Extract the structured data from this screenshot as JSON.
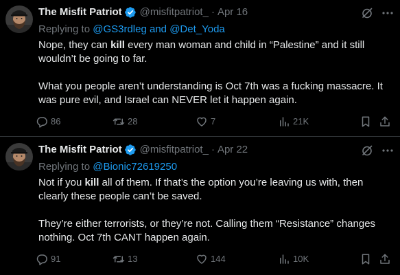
{
  "tweets": [
    {
      "author": {
        "name": "The Misfit Patriot",
        "handle": "@misfitpatriot_",
        "verified": true,
        "avatar": "avatar-bearded-man-cap"
      },
      "separator": "·",
      "date": "Apr 16",
      "reply": {
        "prefix": "Replying to ",
        "mention_1": "@GS3rdleg",
        "joiner": " and ",
        "mention_2": "@Det_Yoda"
      },
      "text": {
        "p1_before": "Nope, they can ",
        "p1_bold": "kill",
        "p1_after": " every man woman and child in “Palestine” and it still wouldn’t be going to far.",
        "p2": "What you people aren’t understanding is Oct 7th was a fucking massacre. It was pure evil, and Israel can NEVER let it happen again."
      },
      "stats": {
        "replies": "86",
        "reposts": "28",
        "likes": "7",
        "views": "21K"
      }
    },
    {
      "author": {
        "name": "The Misfit Patriot",
        "handle": "@misfitpatriot_",
        "verified": true,
        "avatar": "avatar-bearded-man-cap"
      },
      "separator": "·",
      "date": "Apr 22",
      "reply": {
        "prefix": "Replying to ",
        "mention_1": "@Bionic72619250"
      },
      "text": {
        "p1_before": "Not if you ",
        "p1_bold": "kill",
        "p1_after": " all of them. If that’s the option you’re leaving us with, then clearly these people can’t be saved.",
        "p2": "They’re either terrorists, or they’re not. Calling them “Resistance” changes nothing. Oct 7th CANT happen again."
      },
      "stats": {
        "replies": "91",
        "reposts": "13",
        "likes": "144",
        "views": "10K"
      }
    }
  ],
  "icons": {
    "verified_badge": "verified-badge-icon",
    "grok": "grok-icon",
    "more": "more-options-icon",
    "reply": "reply-icon",
    "repost": "repost-icon",
    "like": "like-icon",
    "views": "views-icon",
    "bookmark": "bookmark-icon",
    "share": "share-icon"
  },
  "colors": {
    "background": "#000000",
    "text": "#e7e9ea",
    "secondary": "#71767b",
    "link": "#1d9bf0",
    "divider": "#2f3336"
  }
}
